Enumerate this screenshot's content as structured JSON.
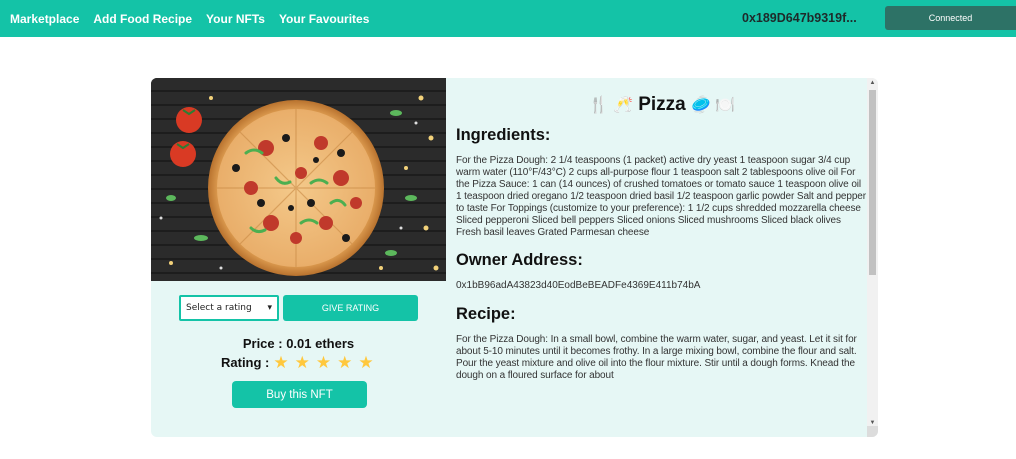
{
  "nav": {
    "links": [
      "Marketplace",
      "Add Food Recipe",
      "Your NFTs",
      "Your Favourites"
    ],
    "wallet": "0x189D647b9319f...",
    "connect_label": "Connected"
  },
  "card": {
    "rating_select": {
      "selected": "Select a rating",
      "options": [
        "Select a rating"
      ]
    },
    "give_rating_label": "GIVE RATING",
    "price": "Price : 0.01 ethers",
    "rating_label": "Rating :",
    "stars": 5,
    "buy_label": "Buy this NFT",
    "title": "Pizza",
    "title_emoji_left": "🍴 🥂",
    "title_emoji_right": "🥏 🍽️",
    "ingredients_heading": "Ingredients:",
    "ingredients_text": "For the Pizza Dough: 2 1/4 teaspoons (1 packet) active dry yeast 1 teaspoon sugar 3/4 cup warm water (110°F/43°C) 2 cups all-purpose flour 1 teaspoon salt 2 tablespoons olive oil For the Pizza Sauce: 1 can (14 ounces) of crushed tomatoes or tomato sauce 1 teaspoon olive oil 1 teaspoon dried oregano 1/2 teaspoon dried basil 1/2 teaspoon garlic powder Salt and pepper to taste For Toppings (customize to your preference): 1 1/2 cups shredded mozzarella cheese Sliced pepperoni Sliced bell peppers Sliced onions Sliced mushrooms Sliced black olives Fresh basil leaves Grated Parmesan cheese",
    "owner_heading": "Owner Address:",
    "owner_address": "0x1bB96adA43823d40EodBeBEADFe4369E411b74bA",
    "recipe_heading": "Recipe:",
    "recipe_text": "For the Pizza Dough: In a small bowl, combine the warm water, sugar, and yeast. Let it sit for about 5-10 minutes until it becomes frothy. In a large mixing bowl, combine the flour and salt. Pour the yeast mixture and olive oil into the flour mixture. Stir until a dough forms. Knead the dough on a floured surface for about"
  },
  "colors": {
    "accent": "#14c3a7",
    "connected_bg": "#2d7266",
    "card_bg": "#e6f7f5",
    "star": "#ffc83d"
  }
}
